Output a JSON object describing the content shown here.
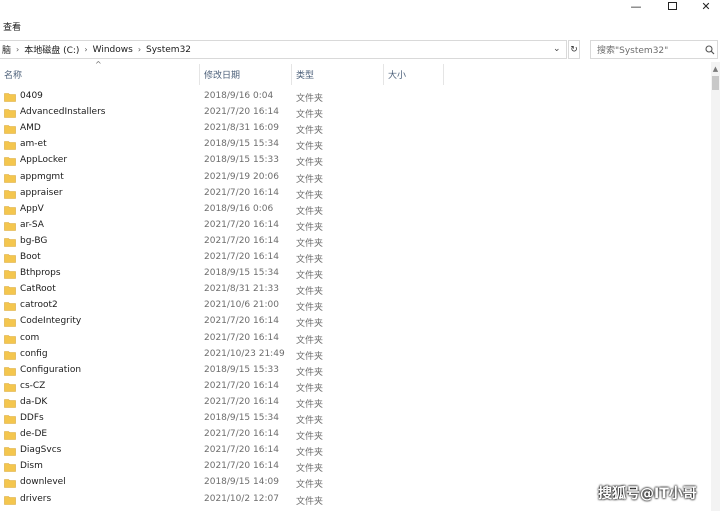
{
  "window": {
    "controls": {
      "minimize": "—",
      "close": "✕"
    }
  },
  "ribbon": {
    "tab_view": "查看"
  },
  "address": {
    "crumbs": [
      "脑",
      "本地磁盘 (C:)",
      "Windows",
      "System32"
    ],
    "separator": "›"
  },
  "search": {
    "placeholder": "搜索\"System32\""
  },
  "columns": {
    "name": "名称",
    "date": "修改日期",
    "type": "类型",
    "size": "大小"
  },
  "files": [
    {
      "name": "0409",
      "date": "2018/9/16 0:04",
      "type": "文件夹"
    },
    {
      "name": "AdvancedInstallers",
      "date": "2021/7/20 16:14",
      "type": "文件夹"
    },
    {
      "name": "AMD",
      "date": "2021/8/31 16:09",
      "type": "文件夹"
    },
    {
      "name": "am-et",
      "date": "2018/9/15 15:34",
      "type": "文件夹"
    },
    {
      "name": "AppLocker",
      "date": "2018/9/15 15:33",
      "type": "文件夹"
    },
    {
      "name": "appmgmt",
      "date": "2021/9/19 20:06",
      "type": "文件夹"
    },
    {
      "name": "appraiser",
      "date": "2021/7/20 16:14",
      "type": "文件夹"
    },
    {
      "name": "AppV",
      "date": "2018/9/16 0:06",
      "type": "文件夹"
    },
    {
      "name": "ar-SA",
      "date": "2021/7/20 16:14",
      "type": "文件夹"
    },
    {
      "name": "bg-BG",
      "date": "2021/7/20 16:14",
      "type": "文件夹"
    },
    {
      "name": "Boot",
      "date": "2021/7/20 16:14",
      "type": "文件夹"
    },
    {
      "name": "Bthprops",
      "date": "2018/9/15 15:34",
      "type": "文件夹"
    },
    {
      "name": "CatRoot",
      "date": "2021/8/31 21:33",
      "type": "文件夹"
    },
    {
      "name": "catroot2",
      "date": "2021/10/6 21:00",
      "type": "文件夹"
    },
    {
      "name": "CodeIntegrity",
      "date": "2021/7/20 16:14",
      "type": "文件夹"
    },
    {
      "name": "com",
      "date": "2021/7/20 16:14",
      "type": "文件夹"
    },
    {
      "name": "config",
      "date": "2021/10/23 21:49",
      "type": "文件夹"
    },
    {
      "name": "Configuration",
      "date": "2018/9/15 15:33",
      "type": "文件夹"
    },
    {
      "name": "cs-CZ",
      "date": "2021/7/20 16:14",
      "type": "文件夹"
    },
    {
      "name": "da-DK",
      "date": "2021/7/20 16:14",
      "type": "文件夹"
    },
    {
      "name": "DDFs",
      "date": "2018/9/15 15:34",
      "type": "文件夹"
    },
    {
      "name": "de-DE",
      "date": "2021/7/20 16:14",
      "type": "文件夹"
    },
    {
      "name": "DiagSvcs",
      "date": "2021/7/20 16:14",
      "type": "文件夹"
    },
    {
      "name": "Dism",
      "date": "2021/7/20 16:14",
      "type": "文件夹"
    },
    {
      "name": "downlevel",
      "date": "2018/9/15 14:09",
      "type": "文件夹"
    },
    {
      "name": "drivers",
      "date": "2021/10/2 12:07",
      "type": "文件夹"
    }
  ],
  "watermark": "搜狐号@IT小哥",
  "colors": {
    "folder": "#f4c64e",
    "header_text": "#4c607a",
    "muted": "#6d6d6d"
  }
}
